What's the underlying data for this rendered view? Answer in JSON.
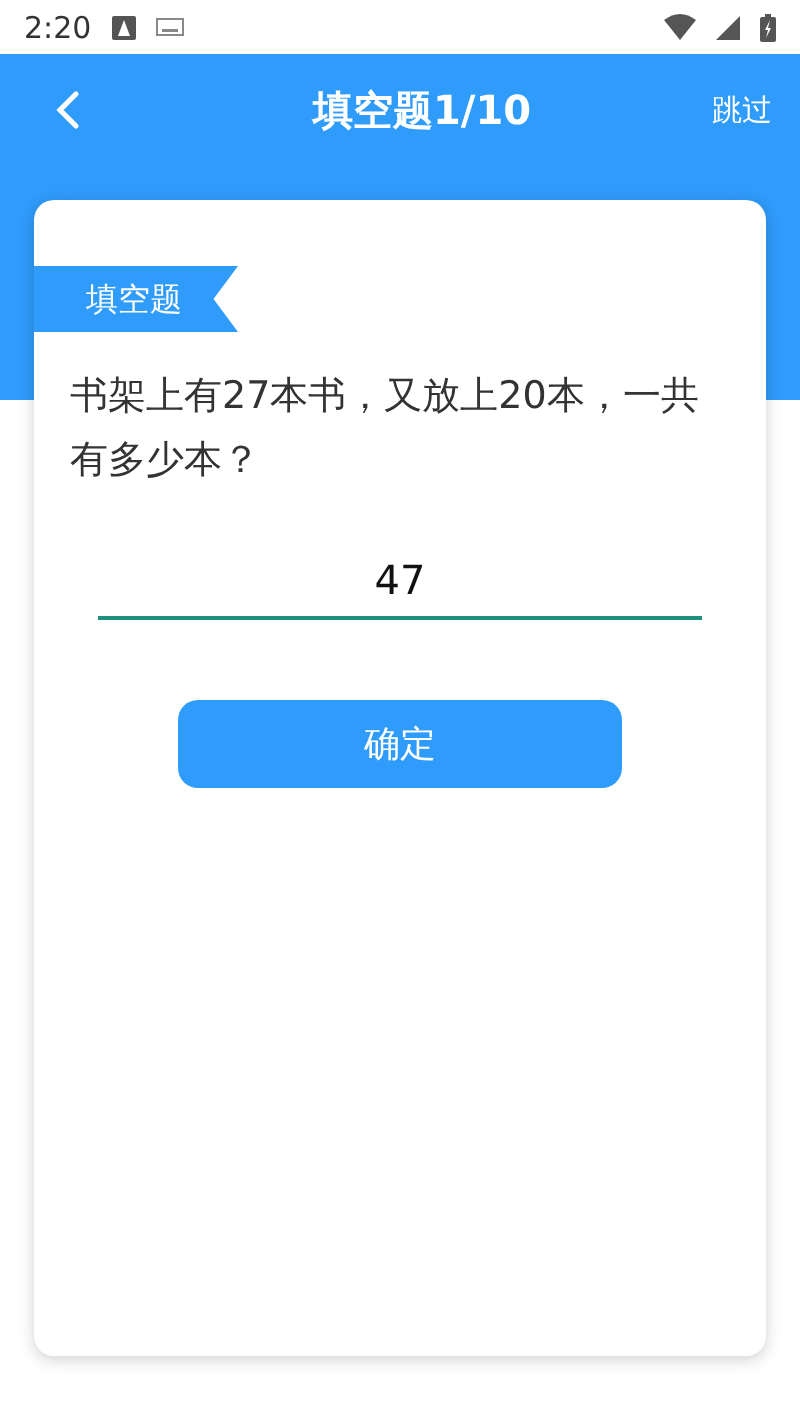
{
  "status_bar": {
    "time": "2:20"
  },
  "header": {
    "title": "填空题1/10",
    "action": "跳过"
  },
  "question": {
    "tag": "填空题",
    "text": "书架上有27本书，又放上20本，一共有多少本？",
    "answer": "47"
  },
  "buttons": [
    {
      "label": "确定",
      "kind": "primary"
    }
  ]
}
